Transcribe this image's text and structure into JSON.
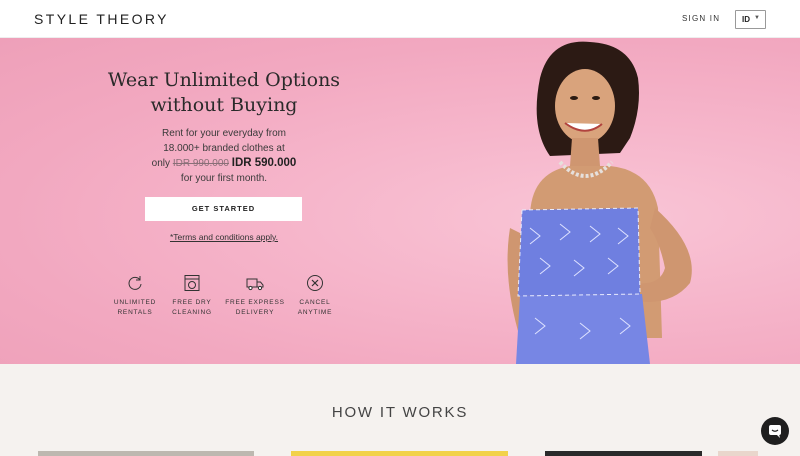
{
  "header": {
    "logo": "STYLE THEORY",
    "signin_label": "SIGN IN",
    "language": "ID"
  },
  "hero": {
    "title_line1": "Wear Unlimited Options",
    "title_line2": "without Buying",
    "sub_line1": "Rent for your everyday from",
    "sub_line2": "18.000+ branded clothes at",
    "sub_only": "only",
    "old_price": "IDR 990.000",
    "new_price": "IDR 590.000",
    "sub_line4": "for your first month.",
    "cta_label": "GET STARTED",
    "terms_label": "*Terms and conditions apply."
  },
  "features": [
    {
      "icon": "refresh-icon",
      "label": "UNLIMITED\nRENTALS"
    },
    {
      "icon": "washing-machine-icon",
      "label": "FREE DRY\nCLEANING"
    },
    {
      "icon": "truck-icon",
      "label": "FREE EXPRESS\nDELIVERY"
    },
    {
      "icon": "cancel-circle-icon",
      "label": "CANCEL\nANYTIME"
    }
  ],
  "how_it_works": {
    "title": "HOW IT WORKS"
  },
  "colors": {
    "hero_pink": "#f4b2c7",
    "section_bg": "#f5f2ef",
    "dress_blue": "#6f7fe0"
  }
}
